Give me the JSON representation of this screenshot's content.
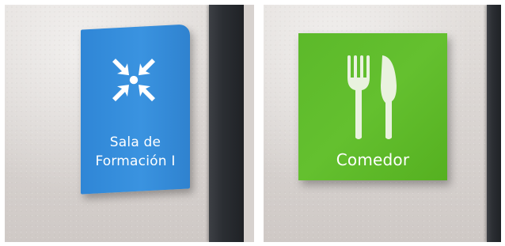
{
  "signs": {
    "left": {
      "line1": "Sala de",
      "line2": "Formación I",
      "icon": "assembly-point-icon",
      "color": "#3a93e0"
    },
    "right": {
      "label": "Comedor",
      "icon": "fork-knife-icon",
      "color": "#5fbd2b"
    }
  }
}
